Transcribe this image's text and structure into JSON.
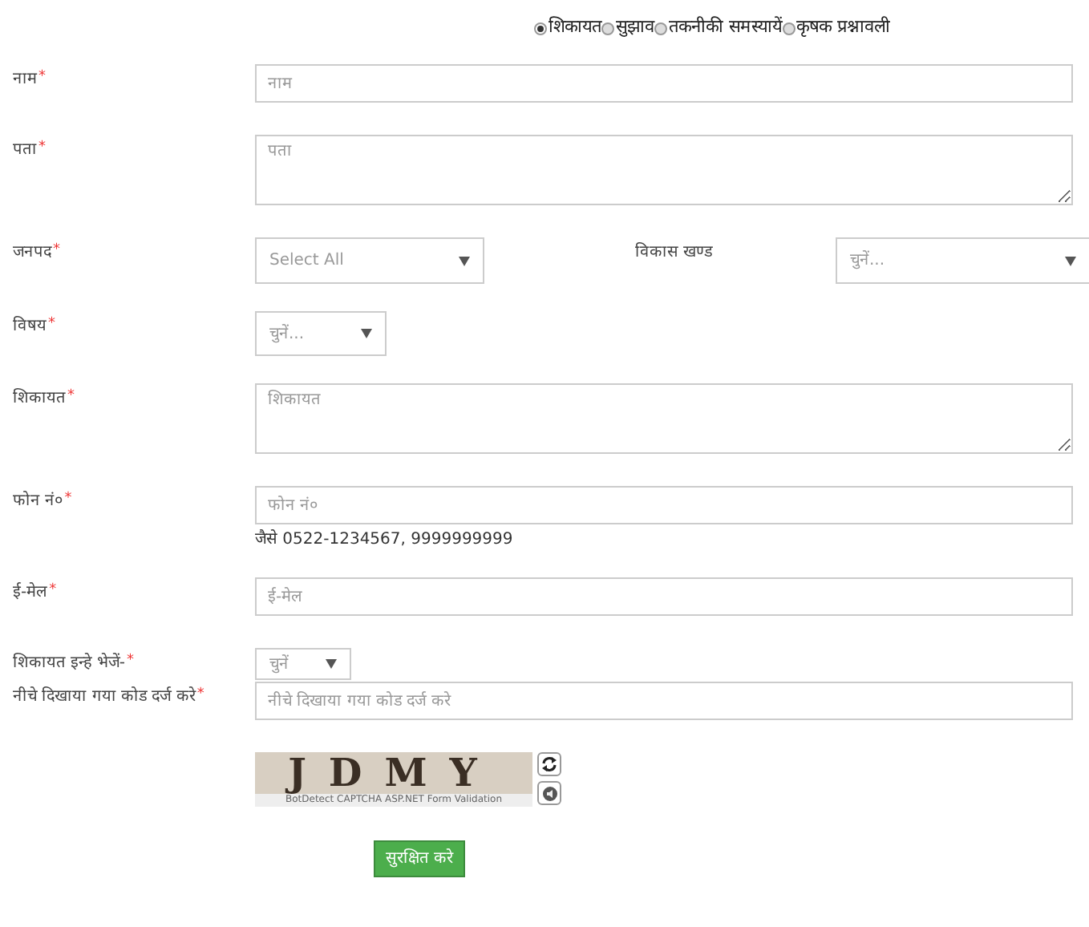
{
  "radios": [
    {
      "label": "शिकायत",
      "selected": true
    },
    {
      "label": "सुझाव",
      "selected": false
    },
    {
      "label": "तकनीकी समस्यायें",
      "selected": false
    },
    {
      "label": "कृषक प्रश्नावली",
      "selected": false
    }
  ],
  "fields": [
    {
      "kind": "text",
      "label": "नाम",
      "mark": "*",
      "placeholder": "नाम"
    },
    {
      "kind": "textarea",
      "label": "पता",
      "mark": "*",
      "placeholder": "पता"
    },
    {
      "kind": "select_pair",
      "label": "जनपद",
      "mark": "*",
      "value": "Select All",
      "label_2": "विकास खण्ड",
      "value_2": "चुनें..."
    },
    {
      "kind": "select",
      "label": "विषय",
      "mark": "*",
      "value": "चुनें..."
    },
    {
      "kind": "textarea",
      "label": "शिकायत",
      "mark": "*",
      "placeholder": "शिकायत"
    },
    {
      "kind": "text",
      "label": "फोन नं०",
      "mark": "*",
      "placeholder": "फोन नं०",
      "hint": "जैसे 0522-1234567, 9999999999"
    },
    {
      "kind": "text",
      "label": "ई-मेल",
      "mark": "*",
      "placeholder": "ई-मेल"
    },
    {
      "kind": "small_select",
      "label": "शिकायत इन्हे भेजें-",
      "mark": "*",
      "value": "चुनें"
    },
    {
      "kind": "text",
      "label": "नीचे दिखाया गया कोड दर्ज करे",
      "mark": "*",
      "placeholder": "नीचे दिखाया गया कोड दर्ज करे"
    }
  ],
  "captcha": {
    "code": "JDMY",
    "caption": "BotDetect CAPTCHA ASP.NET Form Validation"
  },
  "submit": "सुरक्षित करे"
}
